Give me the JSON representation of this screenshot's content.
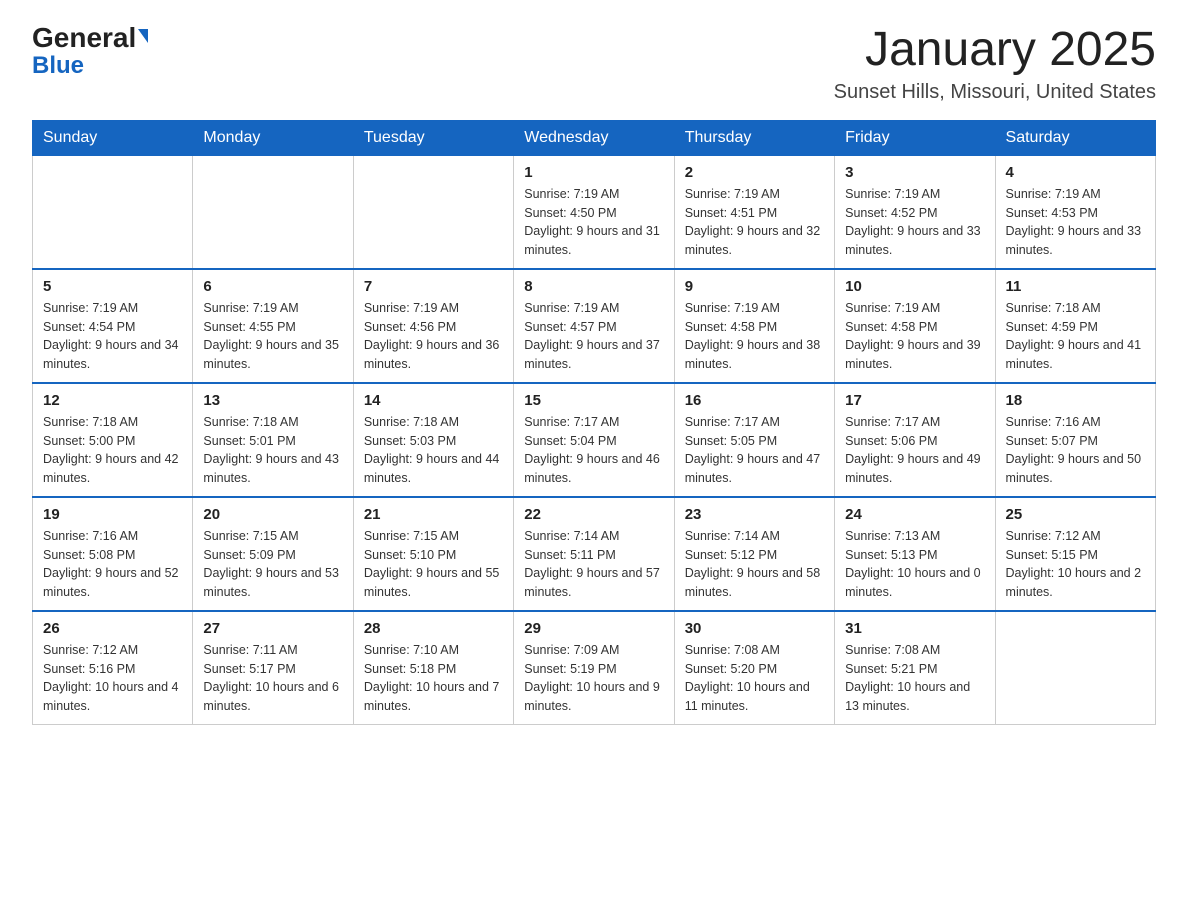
{
  "logo": {
    "text_general": "General",
    "text_blue": "Blue"
  },
  "title": {
    "month_year": "January 2025",
    "location": "Sunset Hills, Missouri, United States"
  },
  "days_of_week": [
    "Sunday",
    "Monday",
    "Tuesday",
    "Wednesday",
    "Thursday",
    "Friday",
    "Saturday"
  ],
  "weeks": [
    [
      {
        "day": "",
        "info": ""
      },
      {
        "day": "",
        "info": ""
      },
      {
        "day": "",
        "info": ""
      },
      {
        "day": "1",
        "info": "Sunrise: 7:19 AM\nSunset: 4:50 PM\nDaylight: 9 hours and 31 minutes."
      },
      {
        "day": "2",
        "info": "Sunrise: 7:19 AM\nSunset: 4:51 PM\nDaylight: 9 hours and 32 minutes."
      },
      {
        "day": "3",
        "info": "Sunrise: 7:19 AM\nSunset: 4:52 PM\nDaylight: 9 hours and 33 minutes."
      },
      {
        "day": "4",
        "info": "Sunrise: 7:19 AM\nSunset: 4:53 PM\nDaylight: 9 hours and 33 minutes."
      }
    ],
    [
      {
        "day": "5",
        "info": "Sunrise: 7:19 AM\nSunset: 4:54 PM\nDaylight: 9 hours and 34 minutes."
      },
      {
        "day": "6",
        "info": "Sunrise: 7:19 AM\nSunset: 4:55 PM\nDaylight: 9 hours and 35 minutes."
      },
      {
        "day": "7",
        "info": "Sunrise: 7:19 AM\nSunset: 4:56 PM\nDaylight: 9 hours and 36 minutes."
      },
      {
        "day": "8",
        "info": "Sunrise: 7:19 AM\nSunset: 4:57 PM\nDaylight: 9 hours and 37 minutes."
      },
      {
        "day": "9",
        "info": "Sunrise: 7:19 AM\nSunset: 4:58 PM\nDaylight: 9 hours and 38 minutes."
      },
      {
        "day": "10",
        "info": "Sunrise: 7:19 AM\nSunset: 4:58 PM\nDaylight: 9 hours and 39 minutes."
      },
      {
        "day": "11",
        "info": "Sunrise: 7:18 AM\nSunset: 4:59 PM\nDaylight: 9 hours and 41 minutes."
      }
    ],
    [
      {
        "day": "12",
        "info": "Sunrise: 7:18 AM\nSunset: 5:00 PM\nDaylight: 9 hours and 42 minutes."
      },
      {
        "day": "13",
        "info": "Sunrise: 7:18 AM\nSunset: 5:01 PM\nDaylight: 9 hours and 43 minutes."
      },
      {
        "day": "14",
        "info": "Sunrise: 7:18 AM\nSunset: 5:03 PM\nDaylight: 9 hours and 44 minutes."
      },
      {
        "day": "15",
        "info": "Sunrise: 7:17 AM\nSunset: 5:04 PM\nDaylight: 9 hours and 46 minutes."
      },
      {
        "day": "16",
        "info": "Sunrise: 7:17 AM\nSunset: 5:05 PM\nDaylight: 9 hours and 47 minutes."
      },
      {
        "day": "17",
        "info": "Sunrise: 7:17 AM\nSunset: 5:06 PM\nDaylight: 9 hours and 49 minutes."
      },
      {
        "day": "18",
        "info": "Sunrise: 7:16 AM\nSunset: 5:07 PM\nDaylight: 9 hours and 50 minutes."
      }
    ],
    [
      {
        "day": "19",
        "info": "Sunrise: 7:16 AM\nSunset: 5:08 PM\nDaylight: 9 hours and 52 minutes."
      },
      {
        "day": "20",
        "info": "Sunrise: 7:15 AM\nSunset: 5:09 PM\nDaylight: 9 hours and 53 minutes."
      },
      {
        "day": "21",
        "info": "Sunrise: 7:15 AM\nSunset: 5:10 PM\nDaylight: 9 hours and 55 minutes."
      },
      {
        "day": "22",
        "info": "Sunrise: 7:14 AM\nSunset: 5:11 PM\nDaylight: 9 hours and 57 minutes."
      },
      {
        "day": "23",
        "info": "Sunrise: 7:14 AM\nSunset: 5:12 PM\nDaylight: 9 hours and 58 minutes."
      },
      {
        "day": "24",
        "info": "Sunrise: 7:13 AM\nSunset: 5:13 PM\nDaylight: 10 hours and 0 minutes."
      },
      {
        "day": "25",
        "info": "Sunrise: 7:12 AM\nSunset: 5:15 PM\nDaylight: 10 hours and 2 minutes."
      }
    ],
    [
      {
        "day": "26",
        "info": "Sunrise: 7:12 AM\nSunset: 5:16 PM\nDaylight: 10 hours and 4 minutes."
      },
      {
        "day": "27",
        "info": "Sunrise: 7:11 AM\nSunset: 5:17 PM\nDaylight: 10 hours and 6 minutes."
      },
      {
        "day": "28",
        "info": "Sunrise: 7:10 AM\nSunset: 5:18 PM\nDaylight: 10 hours and 7 minutes."
      },
      {
        "day": "29",
        "info": "Sunrise: 7:09 AM\nSunset: 5:19 PM\nDaylight: 10 hours and 9 minutes."
      },
      {
        "day": "30",
        "info": "Sunrise: 7:08 AM\nSunset: 5:20 PM\nDaylight: 10 hours and 11 minutes."
      },
      {
        "day": "31",
        "info": "Sunrise: 7:08 AM\nSunset: 5:21 PM\nDaylight: 10 hours and 13 minutes."
      },
      {
        "day": "",
        "info": ""
      }
    ]
  ]
}
